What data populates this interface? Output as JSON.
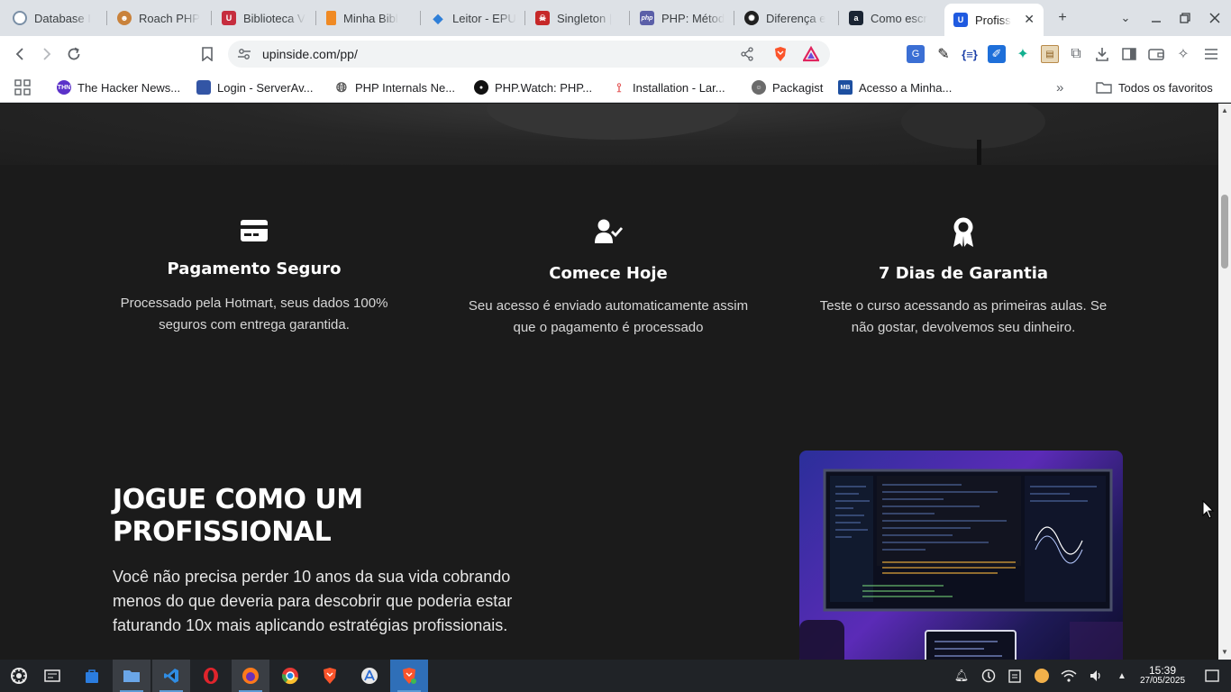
{
  "browser": {
    "tabs": [
      {
        "label": "Database I",
        "icon": "database-icon",
        "color": "#7a8fa6"
      },
      {
        "label": "Roach PHP",
        "icon": "roach-icon",
        "color": "#c9823b"
      },
      {
        "label": "Biblioteca V",
        "icon": "library-icon",
        "color": "#c62d3e"
      },
      {
        "label": "Minha Bibl",
        "icon": "bookmark-orange-icon",
        "color": "#f08a24"
      },
      {
        "label": "Leitor - EPU",
        "icon": "reader-icon",
        "color": "#2f7fd8"
      },
      {
        "label": "Singleton |",
        "icon": "singleton-icon",
        "color": "#c62828"
      },
      {
        "label": "PHP: Métod",
        "icon": "php-icon",
        "color": "#5b5fa8"
      },
      {
        "label": "Diferença e",
        "icon": "openai-icon",
        "color": "#202020"
      },
      {
        "label": "Como escr",
        "icon": "amazon-icon",
        "color": "#1a2433"
      },
      {
        "label": "Profiss",
        "icon": "upinside-icon",
        "color": "#1f5ae0",
        "active": true
      }
    ],
    "url": "upinside.com/pp/",
    "bookmarks": [
      {
        "label": "The Hacker News...",
        "color": "#5b31c9",
        "icon_text": "THN"
      },
      {
        "label": "Login - ServerAv...",
        "color": "#3355a5",
        "icon_text": ""
      },
      {
        "label": "PHP Internals Ne...",
        "color": "#555555",
        "icon_text": ""
      },
      {
        "label": "PHP.Watch: PHP...",
        "color": "#111111",
        "icon_text": ""
      },
      {
        "label": "Installation - Lar...",
        "color": "#e45b5b",
        "icon_text": ""
      },
      {
        "label": "Packagist",
        "color": "#6b6b6b",
        "icon_text": ""
      },
      {
        "label": "Acesso a Minha...",
        "color": "#1d4fa0",
        "icon_text": "MB"
      }
    ],
    "all_bookmarks_label": "Todos os favoritos"
  },
  "page": {
    "features": [
      {
        "title": "Pagamento Seguro",
        "desc_line1": "Processado pela Hotmart, seus dados 100%",
        "desc_line2": "seguros com entrega garantida."
      },
      {
        "title": "Comece Hoje",
        "desc_line1": "Seu acesso é enviado automaticamente assim",
        "desc_line2": "que o pagamento é processado"
      },
      {
        "title": "7 Dias de Garantia",
        "desc_line1": "Teste o curso acessando as primeiras aulas. Se",
        "desc_line2": "não gostar, devolvemos seu dinheiro."
      }
    ],
    "section_title_line1": "JOGUE COMO UM",
    "section_title_line2": "PROFISSIONAL",
    "section_desc_line1": "Você não precisa perder 10 anos da sua vida cobrando",
    "section_desc_line2": "menos do que deveria para descobrir que poderia estar",
    "section_desc_line3": "faturando 10x mais aplicando estratégias profissionais."
  },
  "taskbar": {
    "time": "15:39",
    "date": "27/05/2025"
  }
}
